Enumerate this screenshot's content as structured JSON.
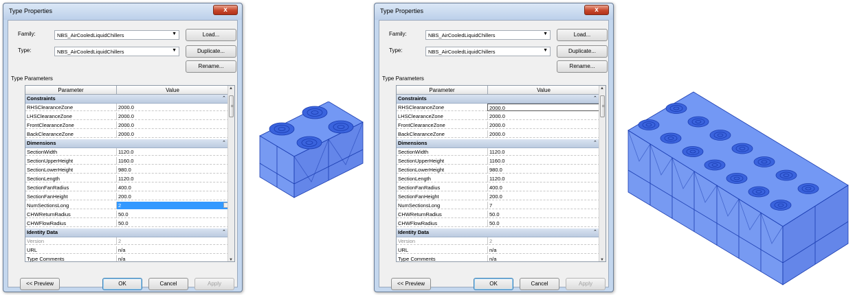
{
  "dialogs": [
    {
      "title": "Type Properties",
      "close_label": "x",
      "family_label": "Family:",
      "family_value": "NBS_AirCooledLiquidChillers",
      "type_label": "Type:",
      "type_value": "NBS_AirCooledLiquidChillers",
      "load_label": "Load...",
      "duplicate_label": "Duplicate...",
      "rename_label": "Rename...",
      "type_parameters_label": "Type Parameters",
      "col_parameter": "Parameter",
      "col_value": "Value",
      "groups": [
        {
          "name": "Constraints",
          "rows": [
            {
              "param": "RHSClearanceZone",
              "value": "2000.0"
            },
            {
              "param": "LHSClearanceZone",
              "value": "2000.0"
            },
            {
              "param": "FrontClearanceZone",
              "value": "2000.0"
            },
            {
              "param": "BackClearanceZone",
              "value": "2000.0"
            }
          ]
        },
        {
          "name": "Dimensions",
          "rows": [
            {
              "param": "SectionWidth",
              "value": "1120.0"
            },
            {
              "param": "SectionUpperHeight",
              "value": "1160.0"
            },
            {
              "param": "SectionLowerHeight",
              "value": "980.0"
            },
            {
              "param": "SectionLength",
              "value": "1120.0"
            },
            {
              "param": "SectionFanRadius",
              "value": "400.0"
            },
            {
              "param": "SectionFanHeight",
              "value": "200.0"
            },
            {
              "param": "NumSectionsLong",
              "value": "2"
            },
            {
              "param": "CHWReturnRadius",
              "value": "50.0"
            },
            {
              "param": "CHWFlowRadius",
              "value": "50.0"
            }
          ]
        },
        {
          "name": "Identity Data",
          "rows": [
            {
              "param": "Version",
              "value": "2"
            },
            {
              "param": "URL",
              "value": "n/a"
            },
            {
              "param": "Type Comments",
              "value": "n/a"
            }
          ]
        }
      ],
      "preview_label": "<< Preview",
      "ok_label": "OK",
      "cancel_label": "Cancel",
      "apply_label": "Apply"
    },
    {
      "title": "Type Properties",
      "close_label": "x",
      "family_label": "Family:",
      "family_value": "NBS_AirCooledLiquidChillers",
      "type_label": "Type:",
      "type_value": "NBS_AirCooledLiquidChillers",
      "load_label": "Load...",
      "duplicate_label": "Duplicate...",
      "rename_label": "Rename...",
      "type_parameters_label": "Type Parameters",
      "col_parameter": "Parameter",
      "col_value": "Value",
      "groups": [
        {
          "name": "Constraints",
          "rows": [
            {
              "param": "RHSClearanceZone",
              "value": "2000.0"
            },
            {
              "param": "LHSClearanceZone",
              "value": "2000.0"
            },
            {
              "param": "FrontClearanceZone",
              "value": "2000.0"
            },
            {
              "param": "BackClearanceZone",
              "value": "2000.0"
            }
          ]
        },
        {
          "name": "Dimensions",
          "rows": [
            {
              "param": "SectionWidth",
              "value": "1120.0"
            },
            {
              "param": "SectionUpperHeight",
              "value": "1160.0"
            },
            {
              "param": "SectionLowerHeight",
              "value": "980.0"
            },
            {
              "param": "SectionLength",
              "value": "1120.0"
            },
            {
              "param": "SectionFanRadius",
              "value": "400.0"
            },
            {
              "param": "SectionFanHeight",
              "value": "200.0"
            },
            {
              "param": "NumSectionsLong",
              "value": "7"
            },
            {
              "param": "CHWReturnRadius",
              "value": "50.0"
            },
            {
              "param": "CHWFlowRadius",
              "value": "50.0"
            }
          ]
        },
        {
          "name": "Identity Data",
          "rows": [
            {
              "param": "Version",
              "value": "2"
            },
            {
              "param": "URL",
              "value": "n/a"
            },
            {
              "param": "Type Comments",
              "value": "n/a"
            }
          ]
        }
      ],
      "preview_label": "<< Preview",
      "ok_label": "OK",
      "cancel_label": "Cancel",
      "apply_label": "Apply"
    }
  ],
  "icons": {
    "dropdown": "chevron-down-icon",
    "collapse": "double-chevron-up-icon",
    "spinner": "spinner-icon",
    "scroll_up": "scroll-up-arrow-icon",
    "scroll_down": "scroll-down-arrow-icon"
  },
  "colors": {
    "chiller_blue": "#2f5fe0",
    "chiller_dark": "#1a3cb0",
    "selection": "#3399ff",
    "group_header": "#c8d6ea"
  }
}
